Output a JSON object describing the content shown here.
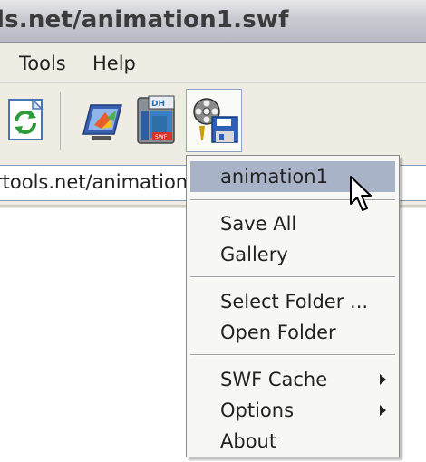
{
  "window": {
    "title": "ls.net/animation1.swf"
  },
  "menubar": {
    "items": [
      {
        "label": "Tools"
      },
      {
        "label": "Help"
      }
    ]
  },
  "toolbar": {
    "buttons": [
      {
        "icon": "refresh-icon"
      },
      {
        "icon": "video-monitor-icon"
      },
      {
        "icon": "swf-file-icon"
      },
      {
        "icon": "save-movie-icon",
        "state": "pressed"
      }
    ]
  },
  "address": {
    "value": "rtools.net/animation1"
  },
  "dropdown": {
    "items": [
      {
        "label": "animation1",
        "highlighted": true
      },
      {
        "label": "Save All"
      },
      {
        "label": "Gallery"
      },
      {
        "label": "Select Folder ..."
      },
      {
        "label": "Open Folder"
      },
      {
        "label": "SWF Cache",
        "submenu": true
      },
      {
        "label": "Options",
        "submenu": true
      },
      {
        "label": "About"
      }
    ]
  },
  "colors": {
    "highlight": "#a9b3c8",
    "chrome": "#eeece3",
    "titlebar": "#c9cad1"
  }
}
